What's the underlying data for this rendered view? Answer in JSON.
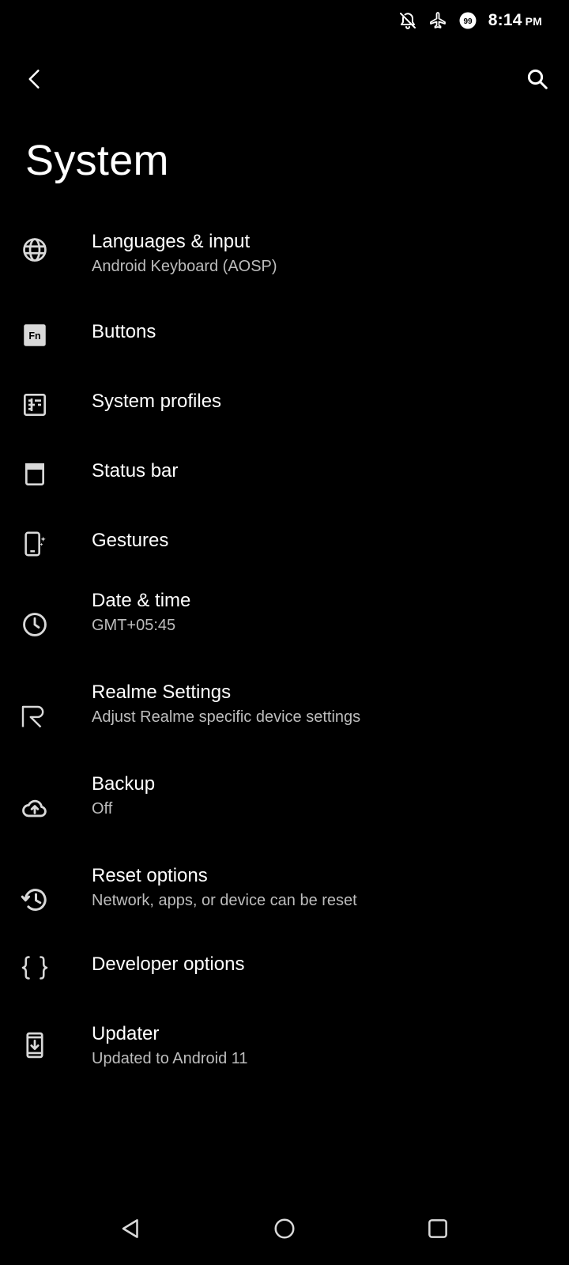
{
  "status_bar": {
    "time": "8:14",
    "ampm": "PM",
    "icons": [
      "notifications-off-icon",
      "airplane-mode-icon",
      "notification-count-icon"
    ],
    "notification_count": "99"
  },
  "toolbar": {
    "back_icon": "back-arrow-icon",
    "search_icon": "search-icon"
  },
  "page": {
    "title": "System"
  },
  "items": [
    {
      "id": "languages",
      "icon": "globe-icon",
      "title": "Languages & input",
      "summary": "Android Keyboard (AOSP)"
    },
    {
      "id": "buttons",
      "icon": "fn-key-icon",
      "title": "Buttons",
      "summary": ""
    },
    {
      "id": "system-profiles",
      "icon": "profiles-icon",
      "title": "System profiles",
      "summary": ""
    },
    {
      "id": "status-bar",
      "icon": "status-bar-icon",
      "title": "Status bar",
      "summary": ""
    },
    {
      "id": "gestures",
      "icon": "gestures-icon",
      "title": "Gestures",
      "summary": ""
    },
    {
      "id": "date-time",
      "icon": "clock-icon",
      "title": "Date & time",
      "summary": "GMT+05:45"
    },
    {
      "id": "realme-settings",
      "icon": "realme-logo-icon",
      "title": "Realme Settings",
      "summary": "Adjust Realme specific device settings"
    },
    {
      "id": "backup",
      "icon": "cloud-upload-icon",
      "title": "Backup",
      "summary": "Off"
    },
    {
      "id": "reset-options",
      "icon": "history-icon",
      "title": "Reset options",
      "summary": "Network, apps, or device can be reset"
    },
    {
      "id": "developer-options",
      "icon": "braces-icon",
      "title": "Developer options",
      "summary": ""
    },
    {
      "id": "updater",
      "icon": "system-update-icon",
      "title": "Updater",
      "summary": "Updated to Android 11"
    }
  ],
  "nav_bar": {
    "back_icon": "nav-back-icon",
    "home_icon": "nav-home-icon",
    "recents_icon": "nav-recents-icon"
  }
}
